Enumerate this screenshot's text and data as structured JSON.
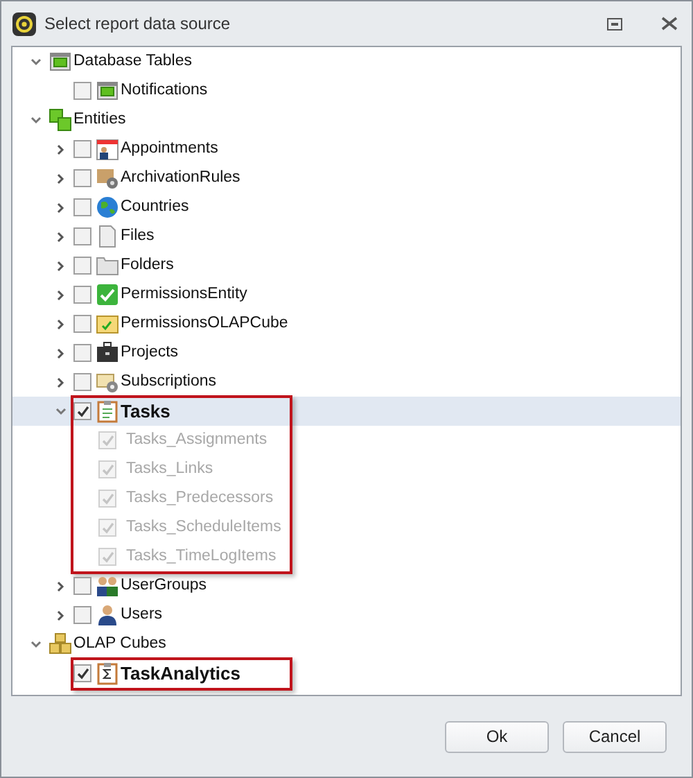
{
  "window": {
    "title": "Select report data source"
  },
  "tree": [
    {
      "label": "Database Tables",
      "expanded": true,
      "children": [
        {
          "label": "Notifications",
          "checked": false
        }
      ]
    },
    {
      "label": "Entities",
      "expanded": true,
      "children": [
        {
          "label": "Appointments",
          "expanded": false,
          "checked": false
        },
        {
          "label": "ArchivationRules",
          "expanded": false,
          "checked": false
        },
        {
          "label": "Countries",
          "expanded": false,
          "checked": false
        },
        {
          "label": "Files",
          "expanded": false,
          "checked": false
        },
        {
          "label": "Folders",
          "expanded": false,
          "checked": false
        },
        {
          "label": "PermissionsEntity",
          "expanded": false,
          "checked": false
        },
        {
          "label": "PermissionsOLAPCube",
          "expanded": false,
          "checked": false
        },
        {
          "label": "Projects",
          "expanded": false,
          "checked": false
        },
        {
          "label": "Subscriptions",
          "expanded": false,
          "checked": false
        },
        {
          "label": "Tasks",
          "expanded": true,
          "checked": true,
          "selected": true,
          "highlighted": true,
          "children": [
            {
              "label": "Tasks_Assignments",
              "checked": true,
              "disabled": true
            },
            {
              "label": "Tasks_Links",
              "checked": true,
              "disabled": true
            },
            {
              "label": "Tasks_Predecessors",
              "checked": true,
              "disabled": true
            },
            {
              "label": "Tasks_ScheduleItems",
              "checked": true,
              "disabled": true
            },
            {
              "label": "Tasks_TimeLogItems",
              "checked": true,
              "disabled": true
            }
          ]
        },
        {
          "label": "UserGroups",
          "expanded": false,
          "checked": false
        },
        {
          "label": "Users",
          "expanded": false,
          "checked": false
        }
      ]
    },
    {
      "label": "OLAP Cubes",
      "expanded": true,
      "children": [
        {
          "label": "TaskAnalytics",
          "checked": true,
          "highlighted": true
        }
      ]
    }
  ],
  "buttons": [
    {
      "label": "Ok"
    },
    {
      "label": "Cancel"
    }
  ]
}
